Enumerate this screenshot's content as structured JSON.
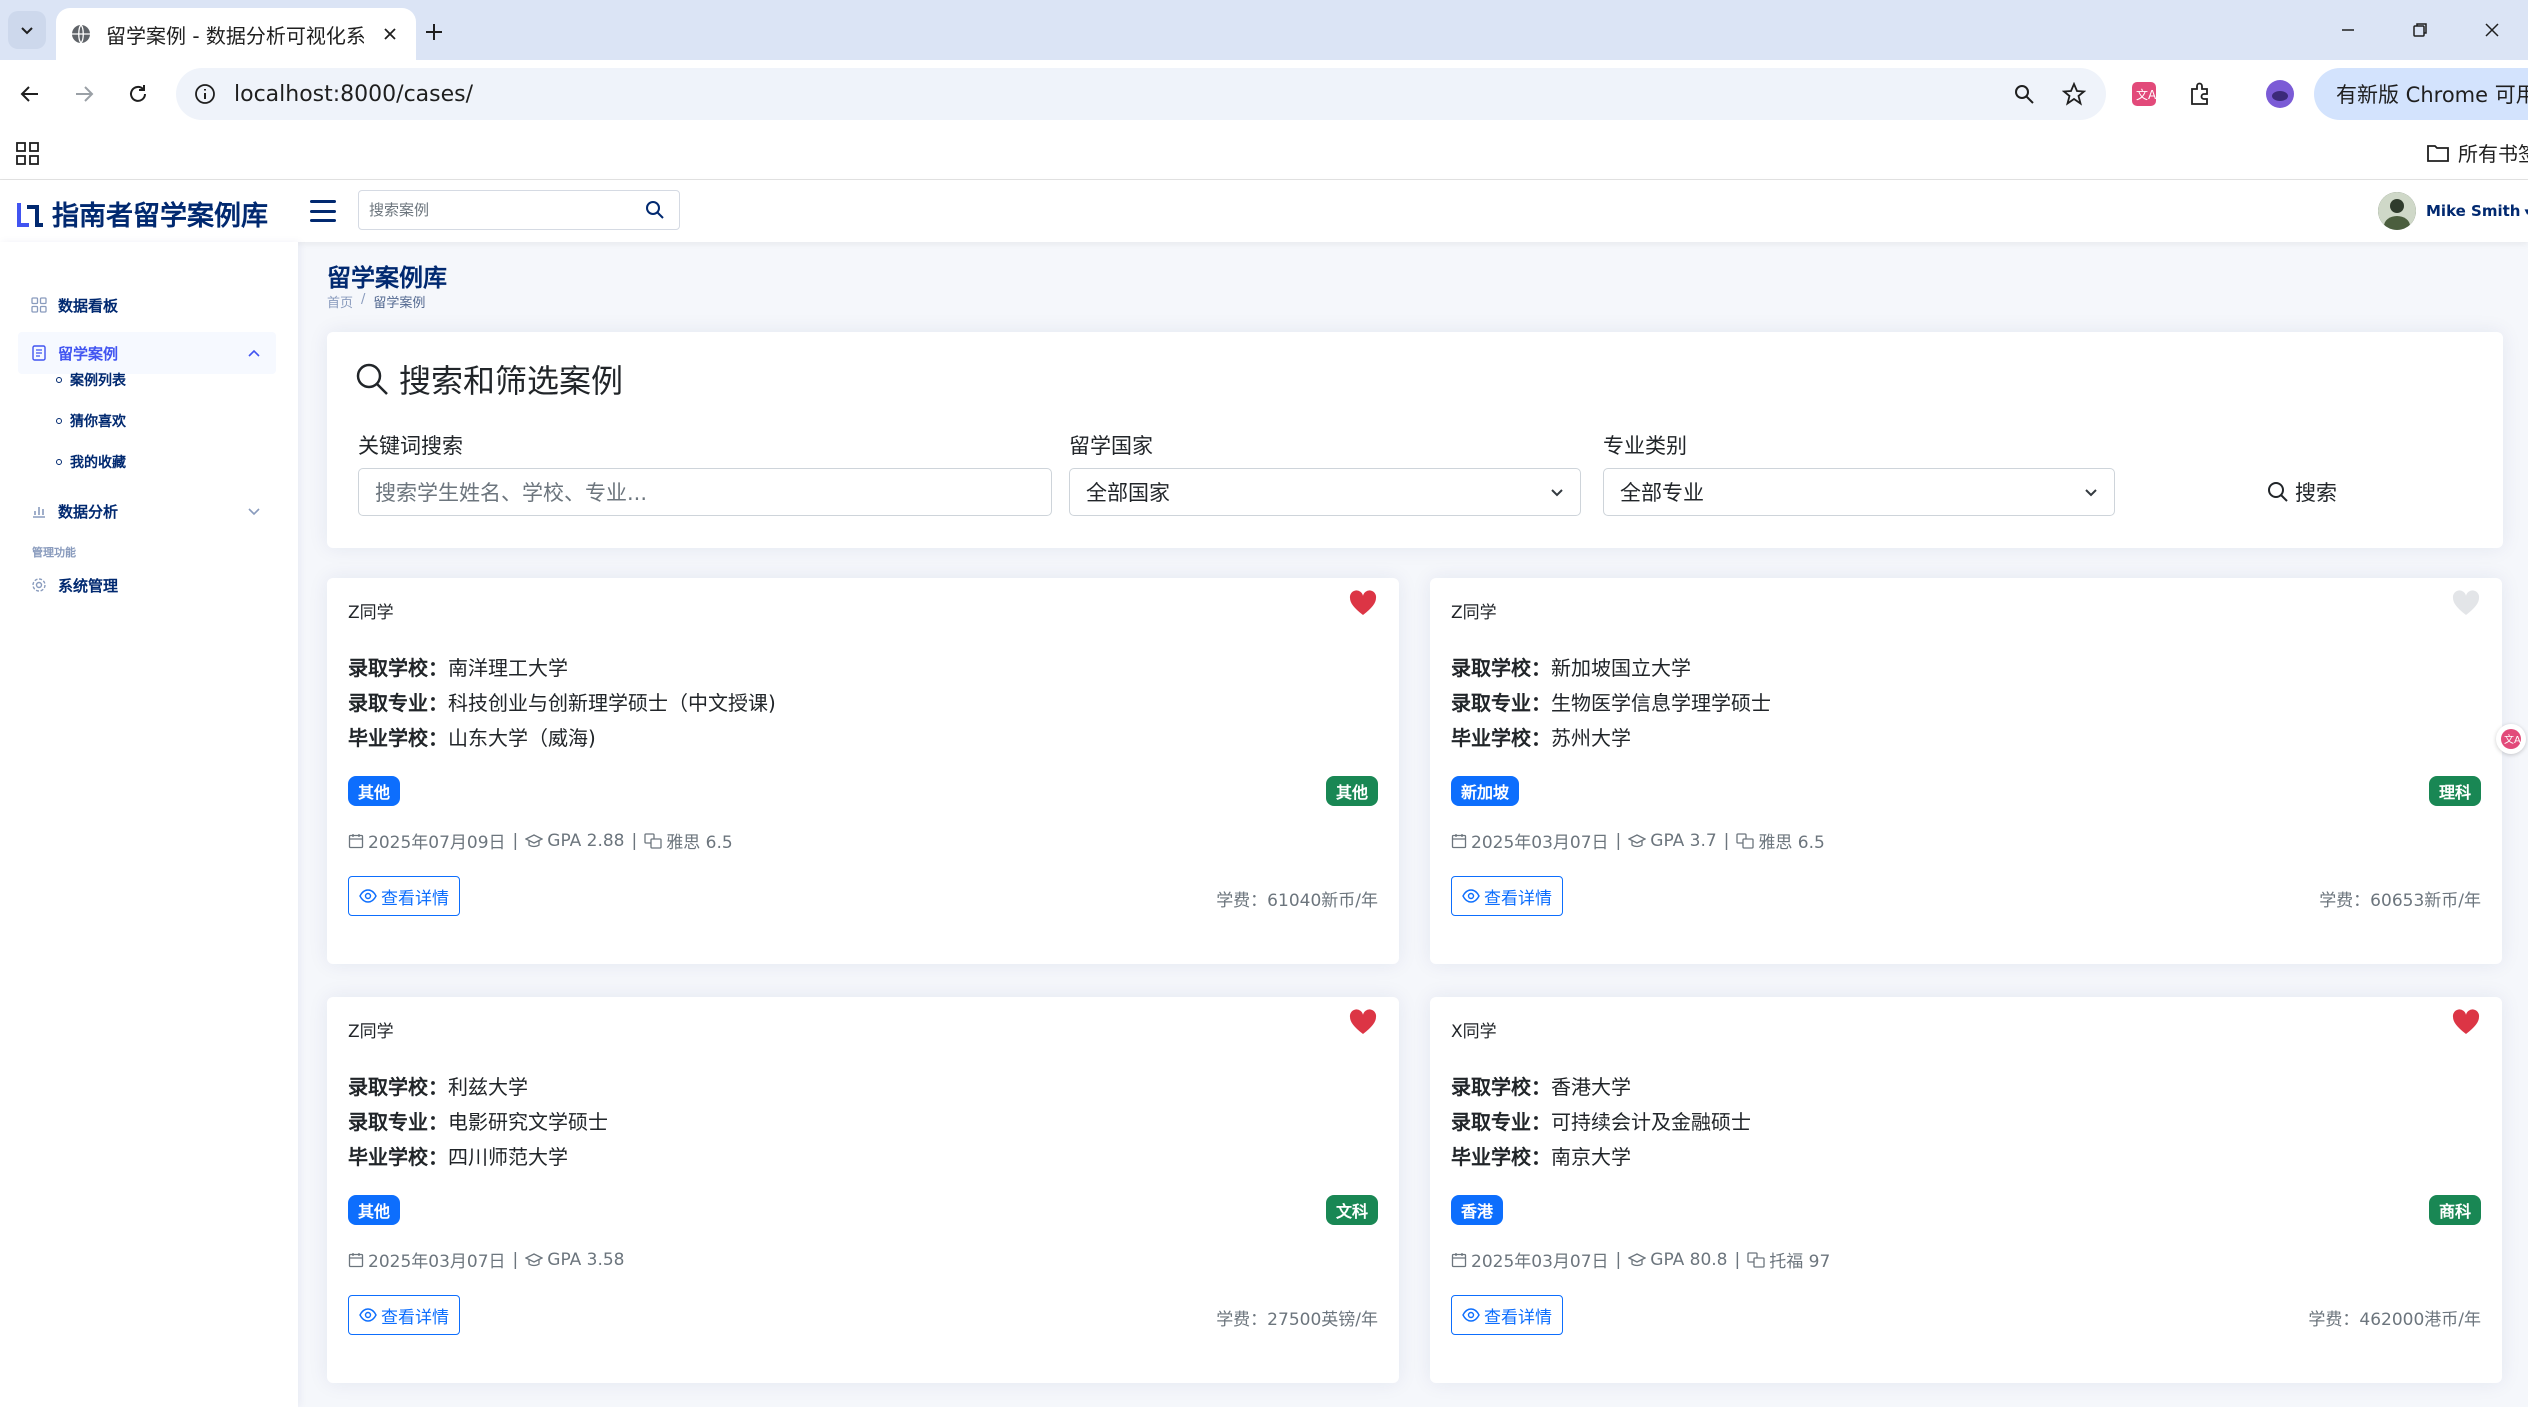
{
  "browser": {
    "tab_title": "留学案例 - 数据分析可视化系统",
    "url": "localhost:8000/cases/",
    "update_label": "有新版 Chrome 可用",
    "bookmarks_label": "所有书签"
  },
  "header": {
    "brand": "指南者留学案例库",
    "search_placeholder": "搜索案例",
    "user_name": "Mike Smith"
  },
  "sidebar": {
    "dashboard": "数据看板",
    "cases": "留学案例",
    "sub_items": [
      "案例列表",
      "猜你喜欢",
      "我的收藏"
    ],
    "analysis": "数据分析",
    "admin_heading": "管理功能",
    "system": "系统管理"
  },
  "page": {
    "title": "留学案例库",
    "breadcrumb_home": "首页",
    "breadcrumb_current": "留学案例"
  },
  "filter": {
    "title": "搜索和筛选案例",
    "keyword_label": "关键词搜索",
    "keyword_placeholder": "搜索学生姓名、学校、专业...",
    "country_label": "留学国家",
    "country_value": "全部国家",
    "major_label": "专业类别",
    "major_value": "全部专业",
    "search_button": "搜索"
  },
  "labels": {
    "school": "录取学校：",
    "major": "录取专业：",
    "grad_school": "毕业学校：",
    "detail_button": "查看详情"
  },
  "cases": [
    {
      "name": "Z同学",
      "favorited": true,
      "school": "南洋理工大学",
      "major": "科技创业与创新理学硕士（中文授课)",
      "grad_school": "山东大学（威海)",
      "country_tag": "其他",
      "category_tag": "其他",
      "date": "2025年07月09日",
      "gpa": "GPA 2.88",
      "lang": "雅思 6.5",
      "fee": "学费：61040新币/年"
    },
    {
      "name": "Z同学",
      "favorited": false,
      "school": "新加坡国立大学",
      "major": "生物医学信息学理学硕士",
      "grad_school": "苏州大学",
      "country_tag": "新加坡",
      "category_tag": "理科",
      "date": "2025年03月07日",
      "gpa": "GPA 3.7",
      "lang": "雅思 6.5",
      "fee": "学费：60653新币/年"
    },
    {
      "name": "Z同学",
      "favorited": true,
      "school": "利兹大学",
      "major": "电影研究文学硕士",
      "grad_school": "四川师范大学",
      "country_tag": "其他",
      "category_tag": "文科",
      "date": "2025年03月07日",
      "gpa": "GPA 3.58",
      "lang": "",
      "fee": "学费：27500英镑/年"
    },
    {
      "name": "X同学",
      "favorited": true,
      "school": "香港大学",
      "major": "可持续会计及金融硕士",
      "grad_school": "南京大学",
      "country_tag": "香港",
      "category_tag": "商科",
      "date": "2025年03月07日",
      "gpa": "GPA 80.8",
      "lang": "托福 97",
      "fee": "学费：462000港币/年"
    }
  ],
  "colors": {
    "brand": "#012970",
    "primary": "#0d6efd",
    "success": "#198754",
    "heart": "#dc3545"
  }
}
